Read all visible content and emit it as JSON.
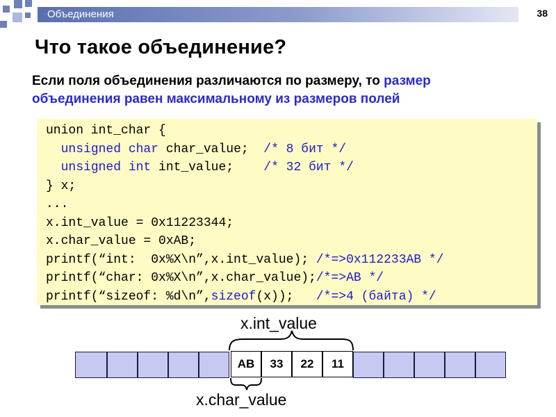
{
  "header": {
    "title": "Объединения",
    "page_number": "38"
  },
  "slide": {
    "title": "Что такое объединение?",
    "intro_plain": "Если поля объединения различаются по размеру, то ",
    "intro_highlight": "размер объединения равен максимальному из размеров полей"
  },
  "code": {
    "lines": [
      [
        "union int_char {"
      ],
      [
        "  ",
        {
          "kw": "unsigned char"
        },
        " char_value;  ",
        {
          "cm": "/* 8 бит */"
        }
      ],
      [
        "  ",
        {
          "kw": "unsigned int"
        },
        " int_value;    ",
        {
          "cm": "/* 32 бит */"
        }
      ],
      [
        "} x;"
      ],
      [
        "..."
      ],
      [
        "x.int_value = 0x11223344;"
      ],
      [
        "x.char_value = 0xAB;"
      ],
      [
        "printf(“int:  0x%X\\n”,x.int_value); ",
        {
          "cm": "/*=>0x112233AB */"
        }
      ],
      [
        "printf(“char: 0x%X\\n”,x.char_value);",
        {
          "cm": "/*=>AB */"
        }
      ],
      [
        "printf(“sizeof: %d\\n”,",
        {
          "kw": "sizeof"
        },
        "(x));   ",
        {
          "cm": "/*=>4 (байта) */"
        }
      ]
    ]
  },
  "memory_diagram": {
    "int_label": "x.int_value",
    "char_label": "x.char_value",
    "bytes": [
      "AB",
      "33",
      "22",
      "11"
    ]
  },
  "colors": {
    "accent": "#2a2acf",
    "code_bg": "#fefcc4",
    "cell_fill": "#c7c9f2",
    "header_bar": "#5b6fb0"
  }
}
